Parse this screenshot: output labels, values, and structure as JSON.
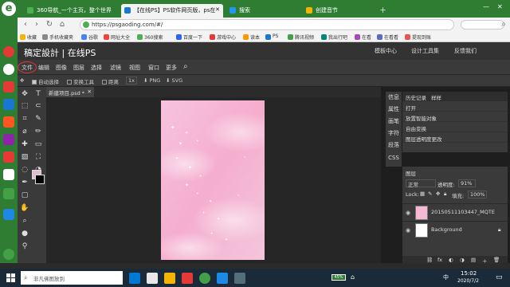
{
  "browser": {
    "logo": "e",
    "tabs": [
      {
        "title": "360导航_一个主页，整个世界",
        "color": "#4caf50",
        "active": false
      },
      {
        "title": "【在线PS】PS软件网页版，ps在",
        "color": "#1976d2",
        "active": true
      },
      {
        "title": "搜索",
        "color": "#2196f3",
        "active": false
      },
      {
        "title": "创建音节",
        "color": "#f4b400",
        "active": false
      }
    ],
    "url": "https://psgaoding.com/#/",
    "bookmarks": [
      {
        "label": "收藏",
        "color": "#f4b400"
      },
      {
        "label": "手机收藏夹",
        "color": "#888"
      },
      {
        "label": "谷歌",
        "color": "#4285f4"
      },
      {
        "label": "网址大全",
        "color": "#f44336"
      },
      {
        "label": "360搜索",
        "color": "#4caf50"
      },
      {
        "label": "百度一下",
        "color": "#2962ff"
      },
      {
        "label": "游戏中心",
        "color": "#e53935"
      },
      {
        "label": "读本",
        "color": "#ff9800"
      },
      {
        "label": "PS",
        "color": "#1976d2"
      },
      {
        "label": "腾讯视频",
        "color": "#43a047"
      },
      {
        "label": "我出行吧",
        "color": "#00897b"
      },
      {
        "label": "在看",
        "color": "#ab47bc"
      },
      {
        "label": "在看看",
        "color": "#5c6bc0"
      },
      {
        "label": "提现到账",
        "color": "#ef5350"
      }
    ]
  },
  "app": {
    "brand": "稿定設計 | 在线PS",
    "header_links": [
      "模板中心",
      "设计工具集",
      "反馈我们"
    ],
    "menus": [
      "文件",
      "编辑",
      "图像",
      "图层",
      "选择",
      "滤镜",
      "视图",
      "窗口",
      "更多"
    ],
    "options": {
      "auto_select": "自动选择",
      "transform": "变换工具",
      "distance": "距离",
      "scale": "1x",
      "png": "PNG",
      "svg": "SVG"
    },
    "doc_tab": "新建项目.psd *",
    "side_strip": [
      "信息",
      "属性",
      "画笔",
      "字符",
      "段落",
      "CSS"
    ],
    "history": {
      "tabs": [
        "历史记录",
        "样样"
      ],
      "items": [
        "打开",
        "放置智能对象",
        "自由变换",
        "图层透明度更改"
      ]
    },
    "layers": {
      "title": "图层",
      "blend": "正常",
      "opacity_label": "透明度:",
      "opacity_value": "91%",
      "lock_label": "Lock:",
      "fill_label": "填充:",
      "fill_value": "100%",
      "items": [
        "20150511103447_MQTE",
        "Background"
      ]
    }
  },
  "taskbar": {
    "search_placeholder": "非凡佛图放到",
    "time": "15:02",
    "date": "2020/7/2",
    "battery": "45%",
    "lang": "中"
  },
  "colors": {
    "browser_green": "#2e7d32",
    "app_dark": "#333333",
    "accent_red": "#e53935"
  }
}
